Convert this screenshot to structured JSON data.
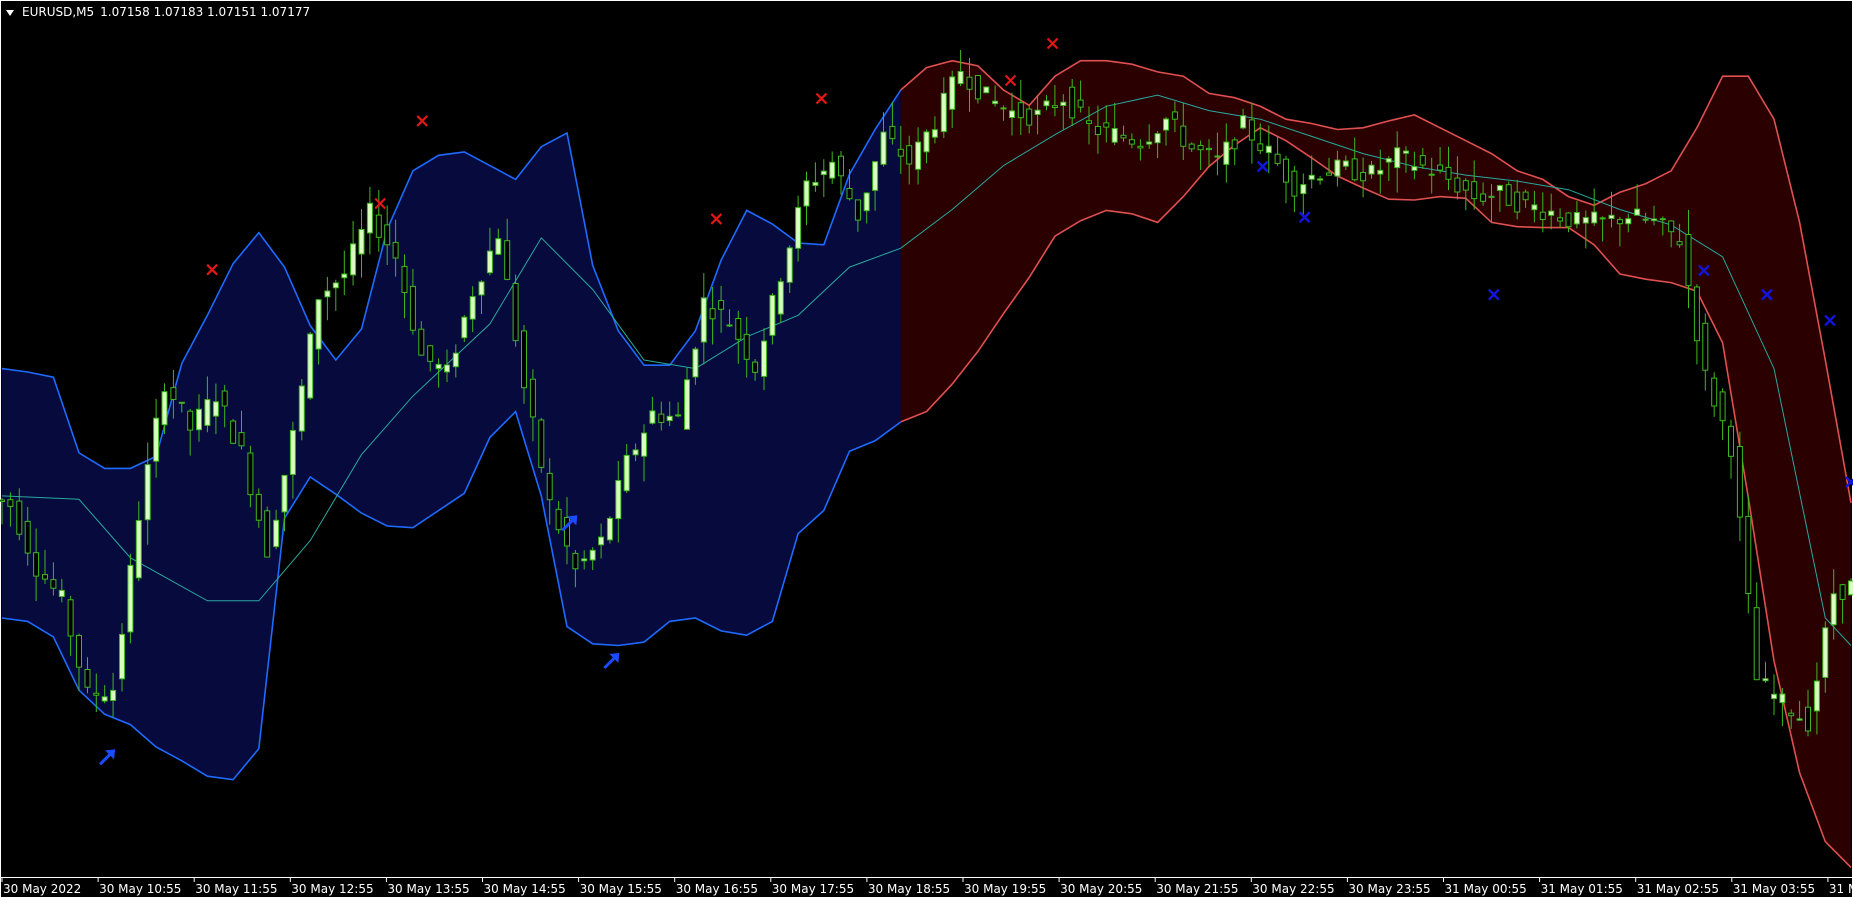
{
  "header": {
    "symbol": "EURUSD,M5",
    "ohlc": "1.07158 1.07183 1.07151 1.07177"
  },
  "colors": {
    "background": "#000000",
    "bull_candle": "#d8ffc0",
    "bear_candle": "#000000",
    "candle_wick": "#3fb81f",
    "band_fill_blue": "#060a3c",
    "band_line_blue": "#1e6bff",
    "band_fill_red": "#2a0000",
    "band_line_red": "#e05050",
    "mid_line": "#2aa8a0",
    "sell_marker": "#e01818",
    "buy_marker_x": "#1414e0",
    "buy_arrow": "#1a4cff"
  },
  "chart_data": {
    "type": "candlestick",
    "symbol": "EURUSD",
    "timeframe": "M5",
    "x_labels": [
      "30 May 2022",
      "30 May 10:55",
      "30 May 11:55",
      "30 May 12:55",
      "30 May 13:55",
      "30 May 14:55",
      "30 May 15:55",
      "30 May 16:55",
      "30 May 17:55",
      "30 May 18:55",
      "30 May 19:55",
      "30 May 20:55",
      "30 May 21:55",
      "30 May 22:55",
      "30 May 23:55",
      "31 May 00:55",
      "31 May 01:55",
      "31 May 02:55",
      "31 May 03:55",
      "31 M"
    ],
    "last_bar": {
      "open": 1.07158,
      "high": 1.07183,
      "low": 1.07151,
      "close": 1.07177
    },
    "band_upper": [
      [
        0,
        0.59
      ],
      [
        1,
        0.586
      ],
      [
        2,
        0.58
      ],
      [
        3,
        0.492
      ],
      [
        4,
        0.474
      ],
      [
        5,
        0.474
      ],
      [
        6,
        0.488
      ],
      [
        7,
        0.596
      ],
      [
        8,
        0.652
      ],
      [
        9,
        0.712
      ],
      [
        10,
        0.748
      ],
      [
        11,
        0.708
      ],
      [
        12,
        0.64
      ],
      [
        13,
        0.6
      ],
      [
        14,
        0.636
      ],
      [
        15,
        0.752
      ],
      [
        16,
        0.82
      ],
      [
        17,
        0.838
      ],
      [
        18,
        0.842
      ],
      [
        19,
        0.826
      ],
      [
        20,
        0.81
      ],
      [
        21,
        0.848
      ],
      [
        22,
        0.864
      ],
      [
        23,
        0.71
      ],
      [
        24,
        0.634
      ],
      [
        25,
        0.594
      ],
      [
        26,
        0.594
      ],
      [
        27,
        0.634
      ],
      [
        28,
        0.716
      ],
      [
        29,
        0.774
      ],
      [
        30,
        0.758
      ],
      [
        31,
        0.736
      ],
      [
        32,
        0.734
      ],
      [
        33,
        0.816
      ],
      [
        34,
        0.868
      ],
      [
        35,
        0.914
      ],
      [
        36,
        0.94
      ],
      [
        37,
        0.948
      ],
      [
        38,
        0.942
      ],
      [
        39,
        0.914
      ],
      [
        40,
        0.896
      ],
      [
        41,
        0.93
      ],
      [
        42,
        0.948
      ],
      [
        43,
        0.948
      ],
      [
        44,
        0.944
      ],
      [
        45,
        0.935
      ],
      [
        46,
        0.93
      ],
      [
        47,
        0.91
      ],
      [
        48,
        0.905
      ],
      [
        49,
        0.895
      ],
      [
        50,
        0.88
      ],
      [
        51,
        0.875
      ],
      [
        52,
        0.868
      ],
      [
        53,
        0.87
      ],
      [
        54,
        0.878
      ],
      [
        55,
        0.885
      ],
      [
        56,
        0.87
      ],
      [
        57,
        0.855
      ],
      [
        58,
        0.84
      ],
      [
        59,
        0.82
      ],
      [
        60,
        0.81
      ],
      [
        61,
        0.79
      ],
      [
        62,
        0.78
      ],
      [
        63,
        0.795
      ],
      [
        64,
        0.805
      ],
      [
        65,
        0.82
      ],
      [
        66,
        0.87
      ],
      [
        67,
        0.93
      ],
      [
        68,
        0.93
      ],
      [
        69,
        0.88
      ],
      [
        70,
        0.76
      ],
      [
        71,
        0.6
      ],
      [
        72,
        0.434
      ]
    ],
    "band_lower": [
      [
        0,
        0.3
      ],
      [
        1,
        0.296
      ],
      [
        2,
        0.278
      ],
      [
        3,
        0.216
      ],
      [
        4,
        0.188
      ],
      [
        5,
        0.176
      ],
      [
        6,
        0.15
      ],
      [
        7,
        0.134
      ],
      [
        8,
        0.116
      ],
      [
        9,
        0.112
      ],
      [
        10,
        0.148
      ],
      [
        11,
        0.416
      ],
      [
        12,
        0.464
      ],
      [
        13,
        0.444
      ],
      [
        14,
        0.422
      ],
      [
        15,
        0.407
      ],
      [
        16,
        0.405
      ],
      [
        17,
        0.425
      ],
      [
        18,
        0.445
      ],
      [
        19,
        0.51
      ],
      [
        20,
        0.54
      ],
      [
        21,
        0.442
      ],
      [
        22,
        0.29
      ],
      [
        23,
        0.27
      ],
      [
        24,
        0.268
      ],
      [
        25,
        0.272
      ],
      [
        26,
        0.296
      ],
      [
        27,
        0.3
      ],
      [
        28,
        0.285
      ],
      [
        29,
        0.28
      ],
      [
        30,
        0.296
      ],
      [
        31,
        0.398
      ],
      [
        32,
        0.425
      ],
      [
        33,
        0.494
      ],
      [
        34,
        0.506
      ],
      [
        35,
        0.528
      ],
      [
        36,
        0.54
      ],
      [
        37,
        0.572
      ],
      [
        38,
        0.61
      ],
      [
        39,
        0.654
      ],
      [
        40,
        0.696
      ],
      [
        41,
        0.744
      ],
      [
        42,
        0.762
      ],
      [
        43,
        0.774
      ],
      [
        44,
        0.77
      ],
      [
        45,
        0.76
      ],
      [
        46,
        0.79
      ],
      [
        47,
        0.825
      ],
      [
        48,
        0.85
      ],
      [
        49,
        0.87
      ],
      [
        50,
        0.855
      ],
      [
        51,
        0.835
      ],
      [
        52,
        0.814
      ],
      [
        53,
        0.8
      ],
      [
        54,
        0.787
      ],
      [
        55,
        0.786
      ],
      [
        56,
        0.79
      ],
      [
        57,
        0.788
      ],
      [
        58,
        0.76
      ],
      [
        59,
        0.755
      ],
      [
        60,
        0.754
      ],
      [
        61,
        0.754
      ],
      [
        62,
        0.734
      ],
      [
        63,
        0.7
      ],
      [
        64,
        0.694
      ],
      [
        65,
        0.69
      ],
      [
        66,
        0.68
      ],
      [
        67,
        0.62
      ],
      [
        68,
        0.44
      ],
      [
        69,
        0.25
      ],
      [
        70,
        0.12
      ],
      [
        71,
        0.04
      ],
      [
        72,
        0.01
      ]
    ],
    "mid_line": [
      [
        0,
        0.442
      ],
      [
        3,
        0.438
      ],
      [
        5,
        0.37
      ],
      [
        8,
        0.32
      ],
      [
        10,
        0.32
      ],
      [
        12,
        0.39
      ],
      [
        14,
        0.49
      ],
      [
        16,
        0.558
      ],
      [
        19,
        0.642
      ],
      [
        21,
        0.742
      ],
      [
        23,
        0.682
      ],
      [
        25,
        0.6
      ],
      [
        27,
        0.59
      ],
      [
        29,
        0.627
      ],
      [
        31,
        0.652
      ],
      [
        33,
        0.708
      ],
      [
        35,
        0.73
      ],
      [
        37,
        0.775
      ],
      [
        39,
        0.826
      ],
      [
        41,
        0.862
      ],
      [
        43,
        0.895
      ],
      [
        45,
        0.908
      ],
      [
        47,
        0.89
      ],
      [
        49,
        0.88
      ],
      [
        51,
        0.86
      ],
      [
        53,
        0.84
      ],
      [
        55,
        0.825
      ],
      [
        57,
        0.815
      ],
      [
        59,
        0.808
      ],
      [
        61,
        0.798
      ],
      [
        63,
        0.775
      ],
      [
        65,
        0.757
      ],
      [
        67,
        0.72
      ],
      [
        69,
        0.59
      ],
      [
        71,
        0.3
      ],
      [
        72,
        0.268
      ]
    ],
    "candles_close": [
      0.432,
      0.36,
      0.32,
      0.21,
      0.218,
      0.42,
      0.575,
      0.52,
      0.56,
      0.492,
      0.38,
      0.512,
      0.675,
      0.7,
      0.77,
      0.72,
      0.605,
      0.584,
      0.68,
      0.748,
      0.568,
      0.432,
      0.355,
      0.388,
      0.48,
      0.538,
      0.532,
      0.668,
      0.645,
      0.592,
      0.7,
      0.804,
      0.83,
      0.768,
      0.86,
      0.83,
      0.878,
      0.938,
      0.905,
      0.888,
      0.884,
      0.906,
      0.87,
      0.862,
      0.855,
      0.88,
      0.846,
      0.83,
      0.872,
      0.84,
      0.803,
      0.82,
      0.822,
      0.816,
      0.836,
      0.825,
      0.81,
      0.79,
      0.792,
      0.78,
      0.772,
      0.76,
      0.76,
      0.768,
      0.76,
      0.74,
      0.58,
      0.5,
      0.228,
      0.2,
      0.18,
      0.33,
      0.34
    ],
    "sell_signals": [
      {
        "bar": 10,
        "level": 0.705
      },
      {
        "bar": 18,
        "level": 0.782
      },
      {
        "bar": 20,
        "level": 0.878
      },
      {
        "bar": 34,
        "level": 0.764
      },
      {
        "bar": 39,
        "level": 0.904
      },
      {
        "bar": 48,
        "level": 0.925
      },
      {
        "bar": 50,
        "level": 0.968
      }
    ],
    "buy_crosses": [
      {
        "bar": 60,
        "level": 0.825
      },
      {
        "bar": 62,
        "level": 0.766
      },
      {
        "bar": 71,
        "level": 0.676
      },
      {
        "bar": 81,
        "level": 0.704
      },
      {
        "bar": 84,
        "level": 0.676
      },
      {
        "bar": 87,
        "level": 0.646
      },
      {
        "bar": 88,
        "level": 0.458
      }
    ],
    "buy_arrows": [
      {
        "bar": 5,
        "level": 0.138
      },
      {
        "bar": 27,
        "level": 0.41
      },
      {
        "bar": 29,
        "level": 0.25
      }
    ]
  }
}
